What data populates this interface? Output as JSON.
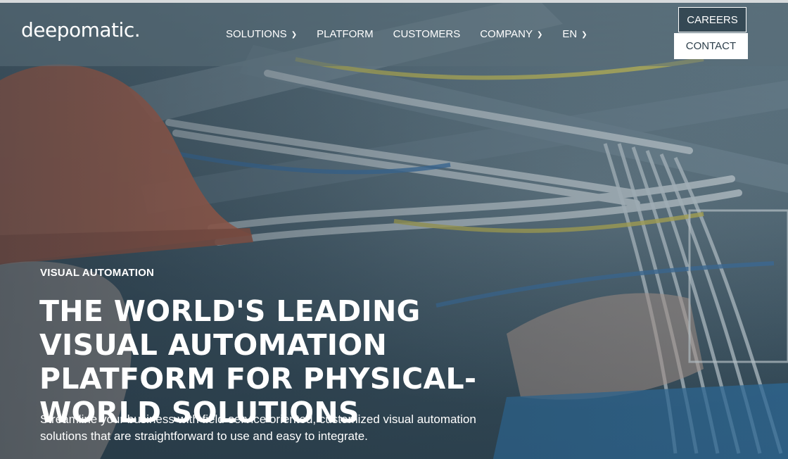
{
  "brand": {
    "logo_text": "deepomatic."
  },
  "nav": {
    "items": [
      {
        "label": "SOLUTIONS",
        "has_dropdown": true,
        "icon": "chevron-down-icon"
      },
      {
        "label": "PLATFORM",
        "has_dropdown": false
      },
      {
        "label": "CUSTOMERS",
        "has_dropdown": false
      },
      {
        "label": "COMPANY",
        "has_dropdown": true,
        "icon": "chevron-down-icon"
      },
      {
        "label": "EN",
        "has_dropdown": true,
        "icon": "chevron-down-icon"
      }
    ]
  },
  "header_actions": {
    "careers_label": "CAREERS",
    "contact_label": "CONTACT"
  },
  "hero": {
    "eyebrow": "VISUAL AUTOMATION",
    "headline": "THE WORLD'S LEADING VISUAL AUTOMATION PLATFORM FOR PHYSICAL-WORLD SOLUTIONS",
    "subtext": "Streamline your business with field-service oriented, customized visual automation solutions that are straightforward to use and easy to integrate."
  },
  "colors": {
    "overlay": "#2b4250",
    "hardhat": "#d2684a",
    "text": "#ffffff",
    "contact_bg": "#ffffff"
  }
}
